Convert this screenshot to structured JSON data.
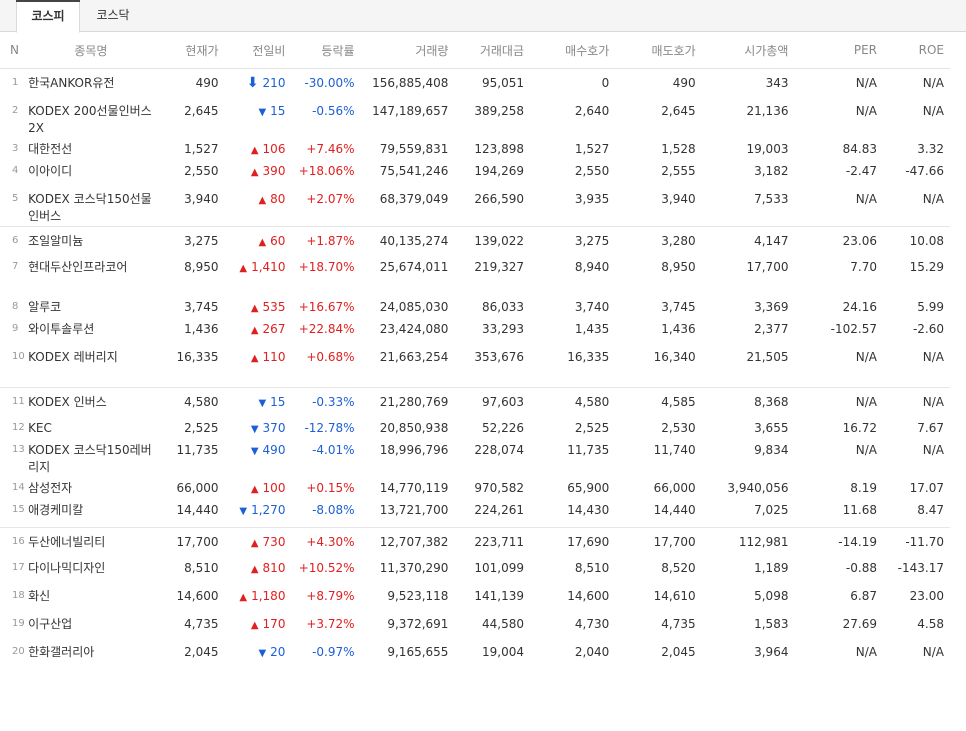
{
  "tabs": [
    {
      "label": "코스피",
      "active": true
    },
    {
      "label": "코스닥",
      "active": false
    }
  ],
  "columns": [
    "N",
    "종목명",
    "현재가",
    "전일비",
    "등락률",
    "거래량",
    "거래대금",
    "매수호가",
    "매도호가",
    "시가총액",
    "PER",
    "ROE"
  ],
  "colors": {
    "up": "#e02020",
    "down": "#1c5fd6"
  },
  "rows": [
    {
      "n": "1",
      "name": "한국ANKOR유전",
      "price": "490",
      "dir": "down-arrow",
      "chg": "210",
      "rate": "-30.00%",
      "vol": "156,885,408",
      "amt": "95,051",
      "bid": "0",
      "ask": "490",
      "cap": "343",
      "per": "N/A",
      "roe": "N/A"
    },
    {
      "n": "2",
      "name": "KODEX 200선물인버스2X",
      "price": "2,645",
      "dir": "down",
      "chg": "15",
      "rate": "-0.56%",
      "vol": "147,189,657",
      "amt": "389,258",
      "bid": "2,640",
      "ask": "2,645",
      "cap": "21,136",
      "per": "N/A",
      "roe": "N/A"
    },
    {
      "n": "3",
      "name": "대한전선",
      "price": "1,527",
      "dir": "up",
      "chg": "106",
      "rate": "+7.46%",
      "vol": "79,559,831",
      "amt": "123,898",
      "bid": "1,527",
      "ask": "1,528",
      "cap": "19,003",
      "per": "84.83",
      "roe": "3.32"
    },
    {
      "n": "4",
      "name": "이아이디",
      "price": "2,550",
      "dir": "up",
      "chg": "390",
      "rate": "+18.06%",
      "vol": "75,541,246",
      "amt": "194,269",
      "bid": "2,550",
      "ask": "2,555",
      "cap": "3,182",
      "per": "-2.47",
      "roe": "-47.66"
    },
    {
      "n": "5",
      "name": "KODEX 코스닥150선물인버스",
      "price": "3,940",
      "dir": "up",
      "chg": "80",
      "rate": "+2.07%",
      "vol": "68,379,049",
      "amt": "266,590",
      "bid": "3,935",
      "ask": "3,940",
      "cap": "7,533",
      "per": "N/A",
      "roe": "N/A"
    },
    {
      "n": "6",
      "name": "조일알미늄",
      "price": "3,275",
      "dir": "up",
      "chg": "60",
      "rate": "+1.87%",
      "vol": "40,135,274",
      "amt": "139,022",
      "bid": "3,275",
      "ask": "3,280",
      "cap": "4,147",
      "per": "23.06",
      "roe": "10.08"
    },
    {
      "n": "7",
      "name": "현대두산인프라코어",
      "price": "8,950",
      "dir": "up",
      "chg": "1,410",
      "rate": "+18.70%",
      "vol": "25,674,011",
      "amt": "219,327",
      "bid": "8,940",
      "ask": "8,950",
      "cap": "17,700",
      "per": "7.70",
      "roe": "15.29"
    },
    {
      "n": "8",
      "name": "알루코",
      "price": "3,745",
      "dir": "up",
      "chg": "535",
      "rate": "+16.67%",
      "vol": "24,085,030",
      "amt": "86,033",
      "bid": "3,740",
      "ask": "3,745",
      "cap": "3,369",
      "per": "24.16",
      "roe": "5.99"
    },
    {
      "n": "9",
      "name": "와이투솔루션",
      "price": "1,436",
      "dir": "up",
      "chg": "267",
      "rate": "+22.84%",
      "vol": "23,424,080",
      "amt": "33,293",
      "bid": "1,435",
      "ask": "1,436",
      "cap": "2,377",
      "per": "-102.57",
      "roe": "-2.60"
    },
    {
      "n": "10",
      "name": "KODEX 레버리지",
      "price": "16,335",
      "dir": "up",
      "chg": "110",
      "rate": "+0.68%",
      "vol": "21,663,254",
      "amt": "353,676",
      "bid": "16,335",
      "ask": "16,340",
      "cap": "21,505",
      "per": "N/A",
      "roe": "N/A"
    },
    {
      "n": "11",
      "name": "KODEX 인버스",
      "price": "4,580",
      "dir": "down",
      "chg": "15",
      "rate": "-0.33%",
      "vol": "21,280,769",
      "amt": "97,603",
      "bid": "4,580",
      "ask": "4,585",
      "cap": "8,368",
      "per": "N/A",
      "roe": "N/A"
    },
    {
      "n": "12",
      "name": "KEC",
      "price": "2,525",
      "dir": "down",
      "chg": "370",
      "rate": "-12.78%",
      "vol": "20,850,938",
      "amt": "52,226",
      "bid": "2,525",
      "ask": "2,530",
      "cap": "3,655",
      "per": "16.72",
      "roe": "7.67"
    },
    {
      "n": "13",
      "name": "KODEX 코스닥150레버리지",
      "price": "11,735",
      "dir": "down",
      "chg": "490",
      "rate": "-4.01%",
      "vol": "18,996,796",
      "amt": "228,074",
      "bid": "11,735",
      "ask": "11,740",
      "cap": "9,834",
      "per": "N/A",
      "roe": "N/A"
    },
    {
      "n": "14",
      "name": "삼성전자",
      "price": "66,000",
      "dir": "up",
      "chg": "100",
      "rate": "+0.15%",
      "vol": "14,770,119",
      "amt": "970,582",
      "bid": "65,900",
      "ask": "66,000",
      "cap": "3,940,056",
      "per": "8.19",
      "roe": "17.07"
    },
    {
      "n": "15",
      "name": "애경케미칼",
      "price": "14,440",
      "dir": "down",
      "chg": "1,270",
      "rate": "-8.08%",
      "vol": "13,721,700",
      "amt": "224,261",
      "bid": "14,430",
      "ask": "14,440",
      "cap": "7,025",
      "per": "11.68",
      "roe": "8.47"
    },
    {
      "n": "16",
      "name": "두산에너빌리티",
      "price": "17,700",
      "dir": "up",
      "chg": "730",
      "rate": "+4.30%",
      "vol": "12,707,382",
      "amt": "223,711",
      "bid": "17,690",
      "ask": "17,700",
      "cap": "112,981",
      "per": "-14.19",
      "roe": "-11.70"
    },
    {
      "n": "17",
      "name": "다이나믹디자인",
      "price": "8,510",
      "dir": "up",
      "chg": "810",
      "rate": "+10.52%",
      "vol": "11,370,290",
      "amt": "101,099",
      "bid": "8,510",
      "ask": "8,520",
      "cap": "1,189",
      "per": "-0.88",
      "roe": "-143.17"
    },
    {
      "n": "18",
      "name": "화신",
      "price": "14,600",
      "dir": "up",
      "chg": "1,180",
      "rate": "+8.79%",
      "vol": "9,523,118",
      "amt": "141,139",
      "bid": "14,600",
      "ask": "14,610",
      "cap": "5,098",
      "per": "6.87",
      "roe": "23.00"
    },
    {
      "n": "19",
      "name": "이구산업",
      "price": "4,735",
      "dir": "up",
      "chg": "170",
      "rate": "+3.72%",
      "vol": "9,372,691",
      "amt": "44,580",
      "bid": "4,730",
      "ask": "4,735",
      "cap": "1,583",
      "per": "27.69",
      "roe": "4.58"
    },
    {
      "n": "20",
      "name": "한화갤러리아",
      "price": "2,045",
      "dir": "down",
      "chg": "20",
      "rate": "-0.97%",
      "vol": "9,165,655",
      "amt": "19,004",
      "bid": "2,040",
      "ask": "2,045",
      "cap": "3,964",
      "per": "N/A",
      "roe": "N/A"
    }
  ]
}
